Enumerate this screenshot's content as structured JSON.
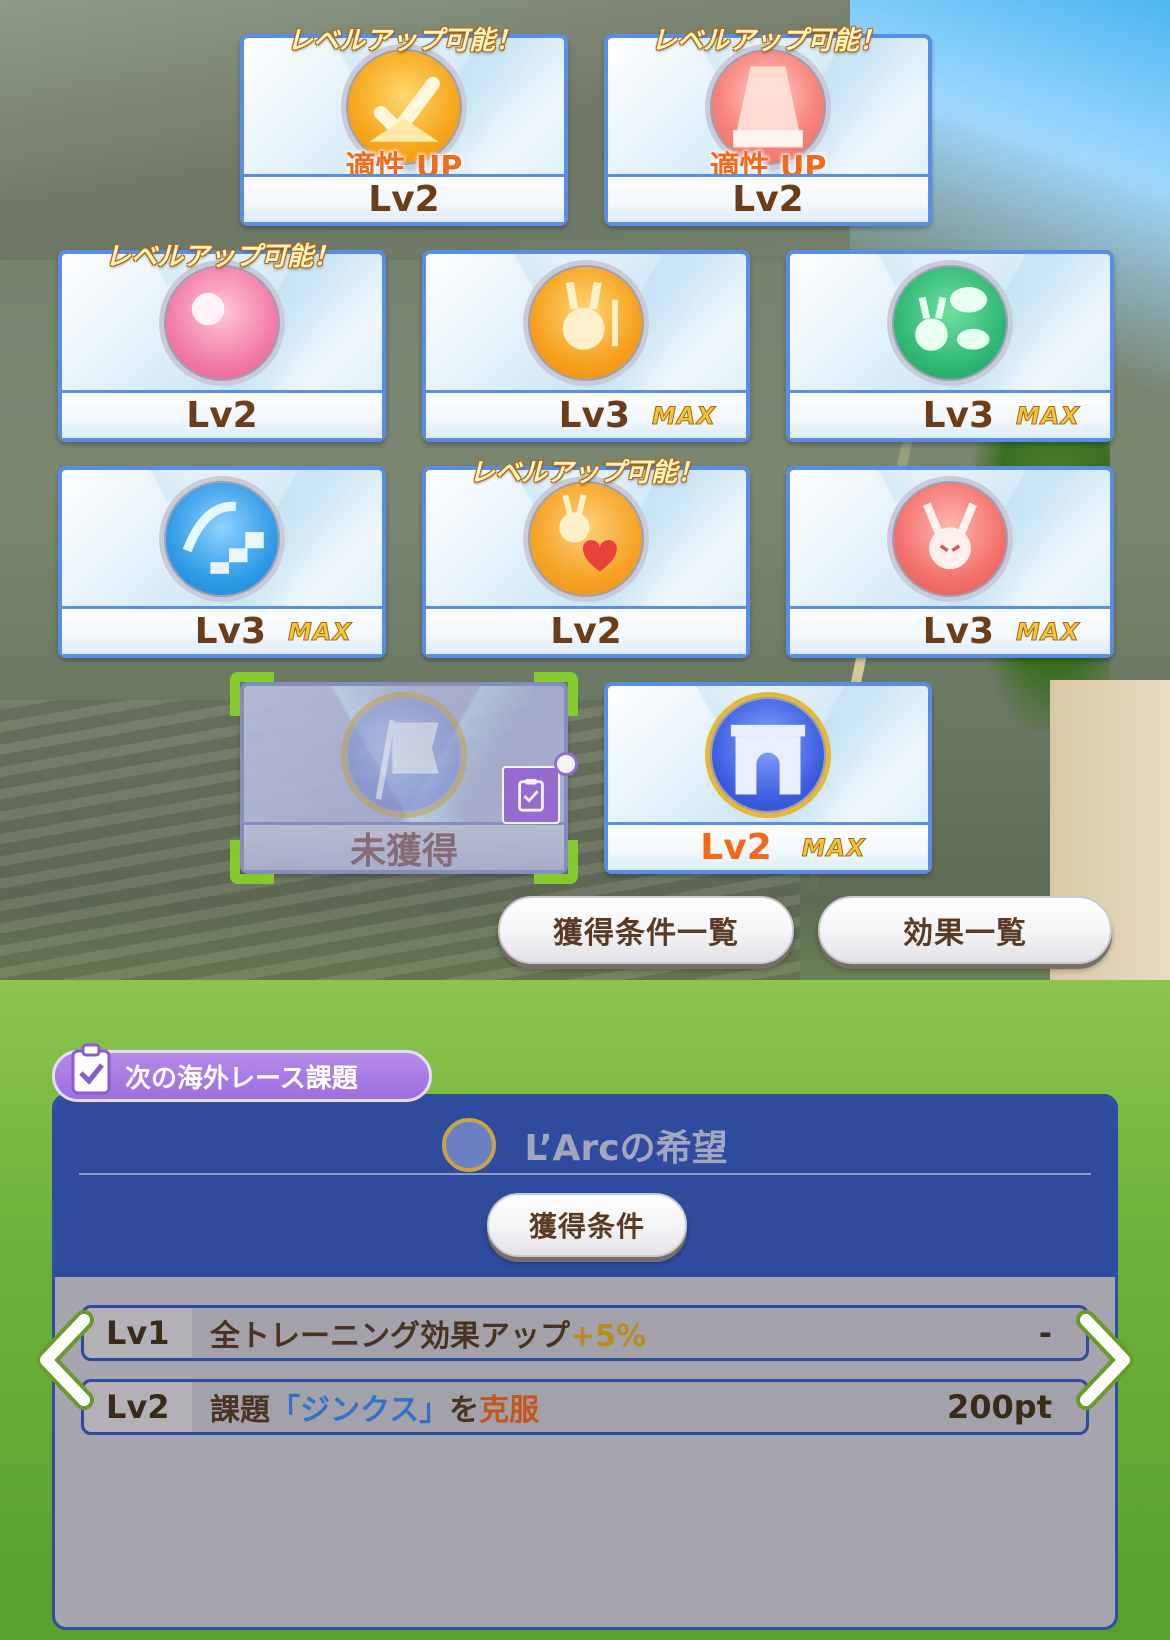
{
  "level_up_label": "レベルアップ可能！",
  "aptitude_up_label": "適性 UP",
  "max_label": "MAX",
  "skills": [
    {
      "level": "Lv2",
      "badge": true,
      "aptitude": true,
      "max": false,
      "icon": "heart-check-icon"
    },
    {
      "level": "Lv2",
      "badge": true,
      "aptitude": true,
      "max": false,
      "icon": "stage-spotlight-icon"
    },
    {
      "level": "Lv2",
      "badge": true,
      "aptitude": false,
      "max": false,
      "icon": "sun-moon-icon"
    },
    {
      "level": "Lv3",
      "badge": false,
      "aptitude": false,
      "max": true,
      "icon": "rabbit-fork-icon"
    },
    {
      "level": "Lv3",
      "badge": false,
      "aptitude": false,
      "max": true,
      "icon": "rabbit-chat-icon"
    },
    {
      "level": "Lv3",
      "badge": false,
      "aptitude": false,
      "max": true,
      "icon": "stairs-arrow-icon"
    },
    {
      "level": "Lv2",
      "badge": true,
      "aptitude": false,
      "max": false,
      "icon": "rabbit-heart-icon"
    },
    {
      "level": "Lv3",
      "badge": false,
      "aptitude": false,
      "max": true,
      "icon": "devil-rabbit-icon"
    },
    {
      "level": "未獲得",
      "badge": false,
      "aptitude": false,
      "max": false,
      "icon": "flag-wand-icon"
    },
    {
      "level": "Lv2",
      "badge": false,
      "aptitude": false,
      "max": true,
      "icon": "arc-de-triomphe-icon"
    }
  ],
  "buttons": {
    "conditions_list": "獲得条件一覧",
    "effects_list": "効果一覧",
    "conditions": "獲得条件"
  },
  "task": {
    "header": "次の海外レース課題",
    "title": "L’Arcの希望",
    "rows": [
      {
        "level": "Lv1",
        "desc_pre": "全トレーニング効果アップ",
        "desc_hl": "+5%",
        "desc_hl2": "",
        "desc_post": "",
        "value": "-"
      },
      {
        "level": "Lv2",
        "desc_pre": "課題",
        "desc_hl": "",
        "desc_hl2": "「ジンクス」",
        "desc_post": "を",
        "desc_hl3": "克服",
        "value": "200pt"
      }
    ]
  },
  "colors": {
    "card_border": "#5a8ee6",
    "panel_blue": "#2f4b9e",
    "task_purple": "#9c6fde",
    "select_green": "#86d22a",
    "level_brown": "#6b3d18",
    "level_orange": "#f06a1a"
  }
}
